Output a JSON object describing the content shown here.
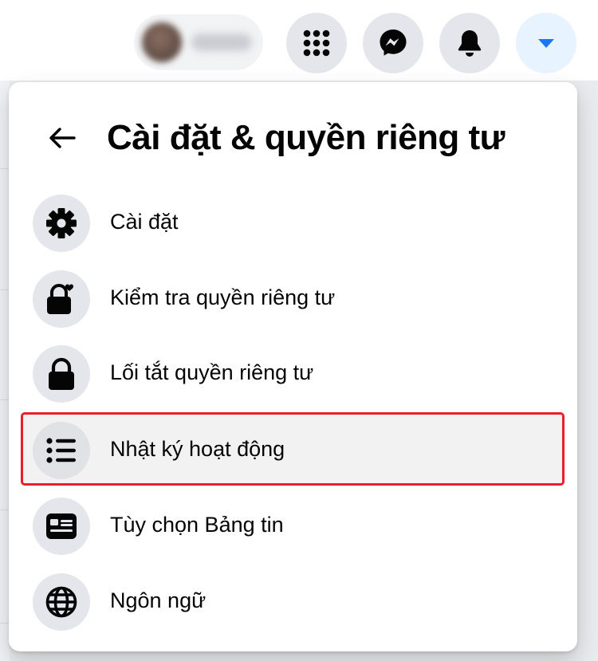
{
  "header": {
    "title": "Cài đặt & quyền riêng tư",
    "back_icon": "arrow-left-icon"
  },
  "topbar": {
    "buttons": [
      {
        "icon": "grid-menu-icon"
      },
      {
        "icon": "messenger-icon"
      },
      {
        "icon": "bell-icon"
      },
      {
        "icon": "caret-down-icon",
        "active": true
      }
    ]
  },
  "menu": {
    "items": [
      {
        "label": "Cài đặt",
        "icon": "gear-icon"
      },
      {
        "label": "Kiểm tra quyền riêng tư",
        "icon": "lock-heart-icon"
      },
      {
        "label": "Lối tắt quyền riêng tư",
        "icon": "lock-icon"
      },
      {
        "label": "Nhật ký hoạt động",
        "icon": "list-icon",
        "highlighted": true
      },
      {
        "label": "Tùy chọn Bảng tin",
        "icon": "news-feed-icon"
      },
      {
        "label": "Ngôn ngữ",
        "icon": "globe-icon"
      }
    ]
  },
  "colors": {
    "accent": "#1877f2",
    "highlight_border": "#e8202a",
    "icon_circle": "#e4e6eb",
    "text": "#050505"
  }
}
